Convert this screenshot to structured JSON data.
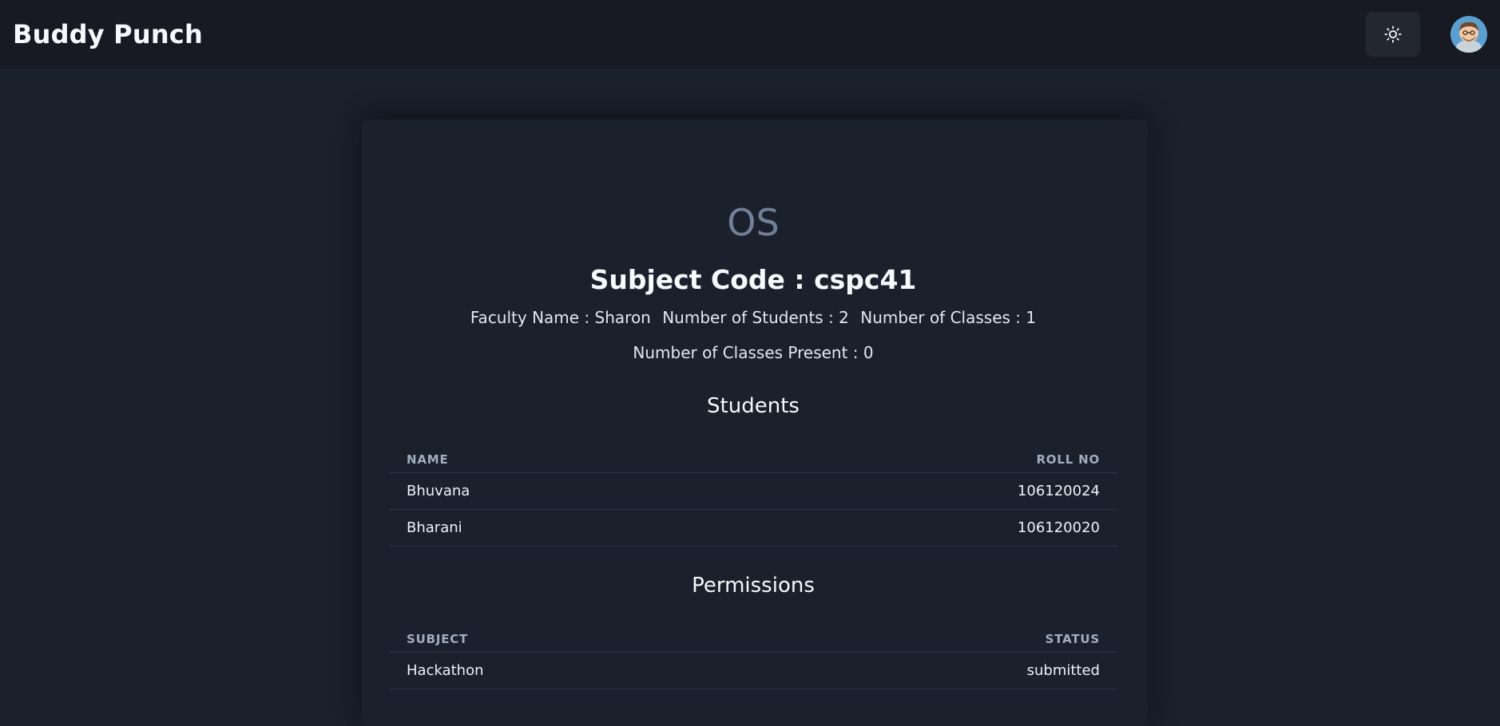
{
  "navbar": {
    "brand": "Buddy Punch",
    "theme_toggle_icon": "sun-icon",
    "avatar_icon": "user-avatar"
  },
  "subject": {
    "name": "OS",
    "code_line": "Subject Code : cspc41",
    "faculty": "Faculty Name : Sharon",
    "num_students": "Number of Students : 2",
    "num_classes": "Number of Classes : 1",
    "classes_present": "Number of Classes Present : 0"
  },
  "students": {
    "title": "Students",
    "headers": [
      "NAME",
      "ROLL NO"
    ],
    "rows": [
      {
        "name": "Bhuvana",
        "roll": "106120024"
      },
      {
        "name": "Bharani",
        "roll": "106120020"
      }
    ]
  },
  "permissions": {
    "title": "Permissions",
    "headers": [
      "SUBJECT",
      "STATUS"
    ],
    "rows": [
      {
        "subject": "Hackathon",
        "status": "submitted"
      }
    ]
  },
  "colors": {
    "background": "#1a202c",
    "navbar": "#171923",
    "subject_name": "#718096",
    "header_text": "#a0aec0"
  }
}
